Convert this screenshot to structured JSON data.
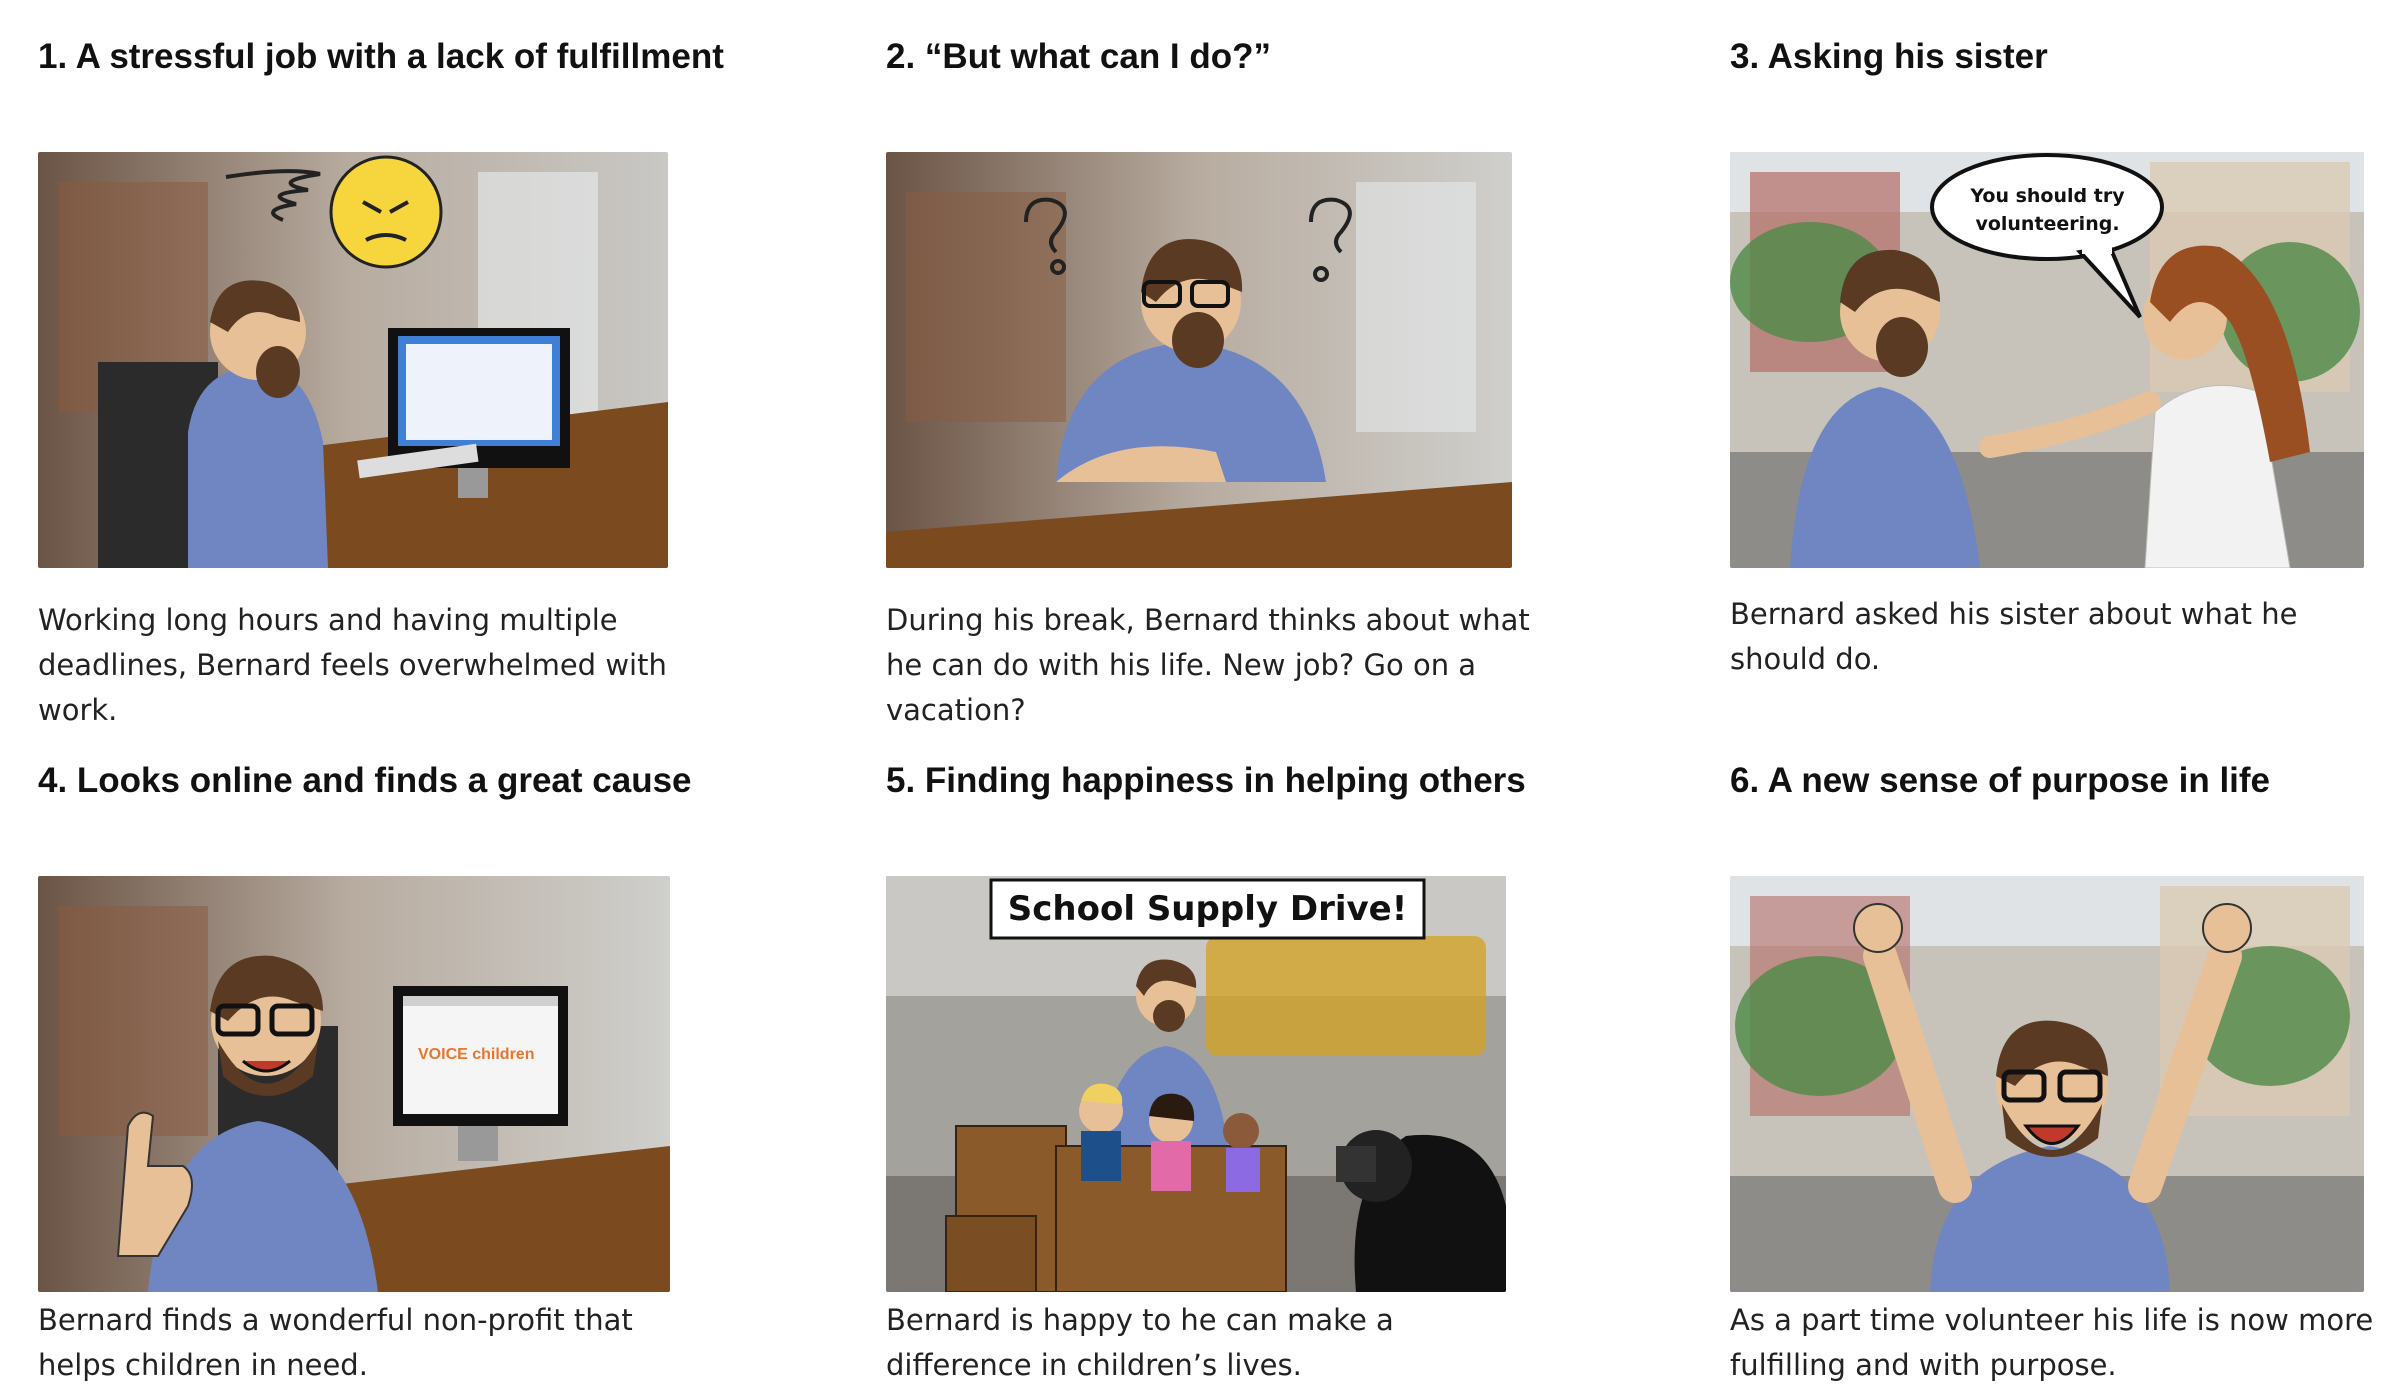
{
  "panels": [
    {
      "title": "1. A stressful job with a lack of fulfillment",
      "caption": "Working long hours and having multiple deadlines, Bernard feels overwhelmed with work."
    },
    {
      "title": "2. “But what can I do?”",
      "caption": "During his break, Bernard thinks about what he can do with his life. New job? Go on a vacation?"
    },
    {
      "title": "3. Asking his sister",
      "caption": "Bernard asked his sister about what he should do.",
      "speech_bubble": "You should try volunteering."
    },
    {
      "title": "4. Looks online and finds a great cause",
      "caption": "Bernard finds a wonderful non-profit that helps children in need.",
      "screen_logo": "VOICE children"
    },
    {
      "title": "5. Finding happiness in helping others",
      "caption": "Bernard is happy to he can make a difference in children’s lives.",
      "sign": "School Supply Drive!"
    },
    {
      "title": "6. A new sense of purpose in life",
      "caption": "As a part time volunteer his life is now more fulfilling and with purpose."
    }
  ],
  "colors": {
    "shirt_blue": "#6f86c2",
    "desk_brown": "#7b4a1e",
    "emoji_yellow": "#f6d53d",
    "skin": "#e7c098",
    "hair": "#5a3a22"
  }
}
